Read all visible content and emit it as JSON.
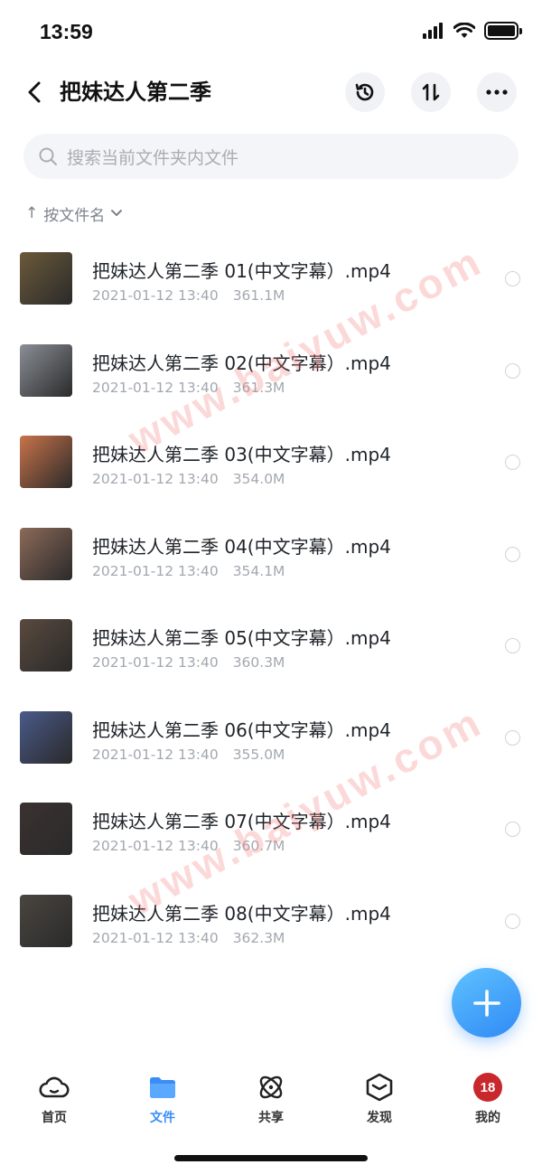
{
  "status_bar": {
    "time": "13:59"
  },
  "header": {
    "title": "把妹达人第二季"
  },
  "search": {
    "placeholder": "搜索当前文件夹内文件"
  },
  "sort": {
    "arrow": "↑",
    "label": "按文件名"
  },
  "files": [
    {
      "name": "把妹达人第二季 01(中文字幕）.mp4",
      "date": "2021-01-12 13:40",
      "size": "361.1M",
      "thumb_color": "#6b5a3a"
    },
    {
      "name": "把妹达人第二季 02(中文字幕）.mp4",
      "date": "2021-01-12 13:40",
      "size": "361.3M",
      "thumb_color": "#8a8f96"
    },
    {
      "name": "把妹达人第二季 03(中文字幕）.mp4",
      "date": "2021-01-12 13:40",
      "size": "354.0M",
      "thumb_color": "#c9734a"
    },
    {
      "name": "把妹达人第二季 04(中文字幕）.mp4",
      "date": "2021-01-12 13:40",
      "size": "354.1M",
      "thumb_color": "#8c6a58"
    },
    {
      "name": "把妹达人第二季 05(中文字幕）.mp4",
      "date": "2021-01-12 13:40",
      "size": "360.3M",
      "thumb_color": "#5a4a3e"
    },
    {
      "name": "把妹达人第二季 06(中文字幕）.mp4",
      "date": "2021-01-12 13:40",
      "size": "355.0M",
      "thumb_color": "#4a5a8a"
    },
    {
      "name": "把妹达人第二季 07(中文字幕）.mp4",
      "date": "2021-01-12 13:40",
      "size": "360.7M",
      "thumb_color": "#3a3230"
    },
    {
      "name": "把妹达人第二季 08(中文字幕）.mp4",
      "date": "2021-01-12 13:40",
      "size": "362.3M",
      "thumb_color": "#4a4640"
    }
  ],
  "watermark": {
    "text": "www.baiyuw.com"
  },
  "tabbar": {
    "items": [
      {
        "label": "首页",
        "icon": "cloud-icon"
      },
      {
        "label": "文件",
        "icon": "folder-icon"
      },
      {
        "label": "共享",
        "icon": "orbit-icon"
      },
      {
        "label": "发现",
        "icon": "cube-icon"
      },
      {
        "label": "我的",
        "icon": "avatar"
      }
    ],
    "active_color": "#3a8df5",
    "avatar_text": "18"
  }
}
